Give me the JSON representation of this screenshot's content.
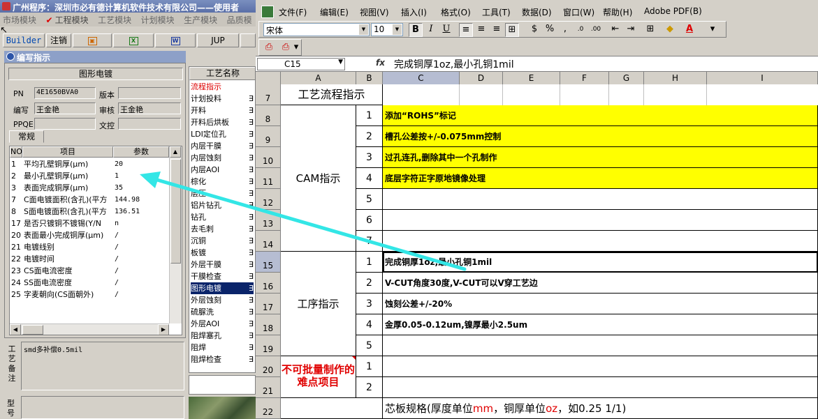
{
  "left_app": {
    "title": "广州程序：深圳市必有德计算机软件技术有限公司——使用者",
    "menu": [
      "市场模块",
      "工程模块",
      "工艺模块",
      "计划模块",
      "生产模块",
      "品质模"
    ],
    "toolbar": {
      "builder": "Builder",
      "logout": "注销",
      "jup": "JUP",
      "excel_icon": "X",
      "word_icon": "W"
    },
    "panel_title": "编写指示",
    "process_name": "图形电镀",
    "fields": {
      "pn_label": "PN",
      "pn_value": "4E1650BVA0",
      "version_label": "版本",
      "version_value": "",
      "writer_label": "编写",
      "writer_value": "王金艳",
      "reviewer_label": "审核",
      "reviewer_value": "王金艳",
      "ppqe_label": "PPQE",
      "ppqe_value": "",
      "wenkong_label": "文控",
      "wenkong_value": ""
    },
    "tab": "常规",
    "param_headers": {
      "no": "NO",
      "item": "项目",
      "param": "参数"
    },
    "params": [
      {
        "no": "1",
        "item": "平均孔壁铜厚(μm)",
        "val": "20"
      },
      {
        "no": "2",
        "item": "最小孔壁铜厚(μm)",
        "val": "1"
      },
      {
        "no": "3",
        "item": "表面完成铜厚(μm)",
        "val": "35"
      },
      {
        "no": "7",
        "item": "C面电镀面积(含孔)(平方",
        "val": "144.98"
      },
      {
        "no": "8",
        "item": "S面电镀面积(含孔)(平方",
        "val": "136.51"
      },
      {
        "no": "17",
        "item": "是否只镀铜不镀锡(Y/N",
        "val": "n"
      },
      {
        "no": "20",
        "item": "表面最小完成铜厚(μm)",
        "val": "/"
      },
      {
        "no": "21",
        "item": "电镀线别",
        "val": "/"
      },
      {
        "no": "22",
        "item": "电镀时间",
        "val": "/"
      },
      {
        "no": "23",
        "item": "CS面电流密度",
        "val": "/"
      },
      {
        "no": "24",
        "item": "SS面电流密度",
        "val": "/"
      },
      {
        "no": "25",
        "item": "字麦朝向(CS面朝外)",
        "val": "/"
      }
    ],
    "notes_label": "工艺备注",
    "notes_value": "smd多补偿0.5mil",
    "model_label": "型号",
    "proc_list_header": "工艺名称",
    "proc_list": [
      {
        "name": "流程指示",
        "sfx": "",
        "state": "red"
      },
      {
        "name": "计划投料",
        "sfx": "∃",
        "state": ""
      },
      {
        "name": "开料",
        "sfx": "∃",
        "state": ""
      },
      {
        "name": "开料后烘板",
        "sfx": "∃",
        "state": ""
      },
      {
        "name": "LDI定位孔",
        "sfx": "∃",
        "state": ""
      },
      {
        "name": "内层干膜",
        "sfx": "∃",
        "state": ""
      },
      {
        "name": "内层蚀刻",
        "sfx": "∃",
        "state": ""
      },
      {
        "name": "内层AOI",
        "sfx": "∃",
        "state": ""
      },
      {
        "name": "棕化",
        "sfx": "∃",
        "state": ""
      },
      {
        "name": "层压",
        "sfx": "∃",
        "state": ""
      },
      {
        "name": "铝片钻孔",
        "sfx": "∃",
        "state": ""
      },
      {
        "name": "钻孔",
        "sfx": "∃",
        "state": ""
      },
      {
        "name": "去毛刺",
        "sfx": "∃",
        "state": ""
      },
      {
        "name": "沉铜",
        "sfx": "∃",
        "state": ""
      },
      {
        "name": "板镀",
        "sfx": "∃",
        "state": ""
      },
      {
        "name": "外层干膜",
        "sfx": "∃",
        "state": ""
      },
      {
        "name": "干膜检查",
        "sfx": "∃",
        "state": ""
      },
      {
        "name": "图形电镀",
        "sfx": "∃",
        "state": "sel"
      },
      {
        "name": "外层蚀刻",
        "sfx": "∃",
        "state": ""
      },
      {
        "name": "硫脲洗",
        "sfx": "∃",
        "state": ""
      },
      {
        "name": "外层AOI",
        "sfx": "∃",
        "state": ""
      },
      {
        "name": "阻焊塞孔",
        "sfx": "∃",
        "state": ""
      },
      {
        "name": "阻焊",
        "sfx": "∃",
        "state": ""
      },
      {
        "name": "阻焊检查",
        "sfx": "∃",
        "state": ""
      }
    ]
  },
  "excel": {
    "menu": [
      "文件(F)",
      "编辑(E)",
      "视图(V)",
      "插入(I)",
      "格式(O)",
      "工具(T)",
      "数据(D)",
      "窗口(W)",
      "帮助(H)",
      "Adobe PDF(B)"
    ],
    "font_name": "宋体",
    "font_size": "10",
    "name_box": "C15",
    "formula": "完成铜厚1oz,最小孔铜1mil",
    "columns": [
      "A",
      "B",
      "C",
      "D",
      "E",
      "F",
      "G",
      "H",
      "I"
    ],
    "rows": [
      "7",
      "8",
      "9",
      "10",
      "11",
      "12",
      "13",
      "14",
      "15",
      "16",
      "17",
      "18",
      "19",
      "20",
      "21",
      "22"
    ],
    "header_cell": "工艺流程指示",
    "cam_label": "CAM指示",
    "cam_items": [
      {
        "n": "1",
        "text": "添加“ROHS”标记"
      },
      {
        "n": "2",
        "text": "槽孔公差按+/-0.075mm控制"
      },
      {
        "n": "3",
        "text": "过孔连孔,删除其中一个孔制作"
      },
      {
        "n": "4",
        "text": "底层字符正字原地镜像处理"
      },
      {
        "n": "5",
        "text": ""
      },
      {
        "n": "6",
        "text": ""
      },
      {
        "n": "7",
        "text": ""
      }
    ],
    "proc_label": "工序指示",
    "proc_items": [
      {
        "n": "1",
        "text": "完成铜厚1oz,最小孔铜1mil"
      },
      {
        "n": "2",
        "text": "V-CUT角度30度,V-CUT可以V穿工艺边"
      },
      {
        "n": "3",
        "text": "蚀刻公差+/-20%"
      },
      {
        "n": "4",
        "text": "金厚0.05-0.12um,镍厚最小2.5um"
      },
      {
        "n": "5",
        "text": ""
      }
    ],
    "difficult_label": "不可批量制作的难点项目",
    "difficult_items": [
      {
        "n": "1"
      },
      {
        "n": "2"
      }
    ],
    "core_spec": {
      "pre": "芯板规格(厚度单位",
      "mm": "mm",
      "mid": "，铜厚单位",
      "oz": "oz",
      "post": "，如0.25 1/1)"
    },
    "accent_yellow": "#ffff00",
    "accent_red": "#e00000"
  },
  "annotation": {
    "arrow_color": "#33e6e6"
  }
}
